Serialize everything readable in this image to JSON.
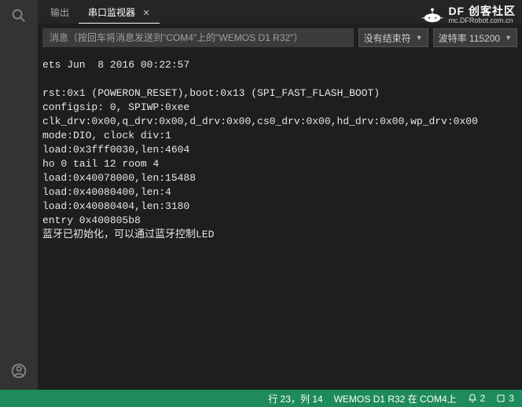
{
  "tabs": {
    "output": "输出",
    "serial": "串口监视器"
  },
  "input": {
    "placeholder": "消息（按回车将消息发送到\"COM4\"上的\"WEMOS D1 R32\"）"
  },
  "dropdowns": {
    "line_ending": "没有结束符",
    "baud": "波特率 115200"
  },
  "logo": {
    "brand": "DF 创客社区",
    "url": "mc.DFRobot.com.cn"
  },
  "console_lines": [
    "ets Jun  8 2016 00:22:57",
    "",
    "rst:0x1 (POWERON_RESET),boot:0x13 (SPI_FAST_FLASH_BOOT)",
    "configsip: 0, SPIWP:0xee",
    "clk_drv:0x00,q_drv:0x00,d_drv:0x00,cs0_drv:0x00,hd_drv:0x00,wp_drv:0x00",
    "mode:DIO, clock div:1",
    "load:0x3fff0030,len:4604",
    "ho 0 tail 12 room 4",
    "load:0x40078000,len:15488",
    "load:0x40080400,len:4",
    "load:0x40080404,len:3180",
    "entry 0x400805b8",
    "蓝牙已初始化，可以通过蓝牙控制LED"
  ],
  "status": {
    "cursor": "行 23，列 14",
    "board": "WEMOS D1 R32 在 COM4上",
    "notifications": "2",
    "extra": "3"
  }
}
